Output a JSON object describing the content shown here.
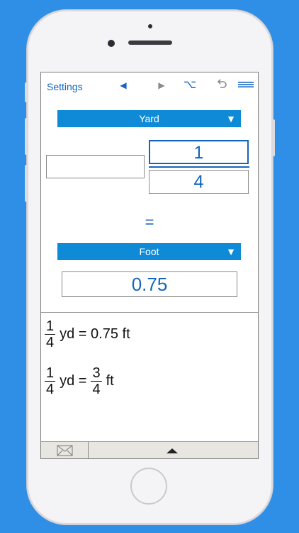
{
  "toolbar": {
    "settings_label": "Settings",
    "icons": {
      "back": "triangle-left-icon",
      "forward": "triangle-right-icon",
      "option": "option-key-icon",
      "undo": "undo-icon",
      "menu": "menu-icon"
    },
    "back_glyph": "◀",
    "forward_glyph": "▶",
    "option_glyph": "⌥"
  },
  "converter": {
    "from_unit": "Yard",
    "to_unit": "Foot",
    "dropdown_arrow": "▼",
    "whole_value": "",
    "numerator": "1",
    "denominator": "4",
    "equals_sign": "=",
    "result_value": "0.75"
  },
  "results": {
    "line1": {
      "numerator": "1",
      "denominator": "4",
      "text": "yd = 0.75 ft"
    },
    "line2": {
      "numerator": "1",
      "denominator": "4",
      "middle": "yd =",
      "result_numerator": "3",
      "result_denominator": "4",
      "unit": "ft"
    }
  },
  "colors": {
    "accent": "#1565c0",
    "dropdown_bg": "#0f8ad6",
    "background": "#2f8fe6"
  }
}
